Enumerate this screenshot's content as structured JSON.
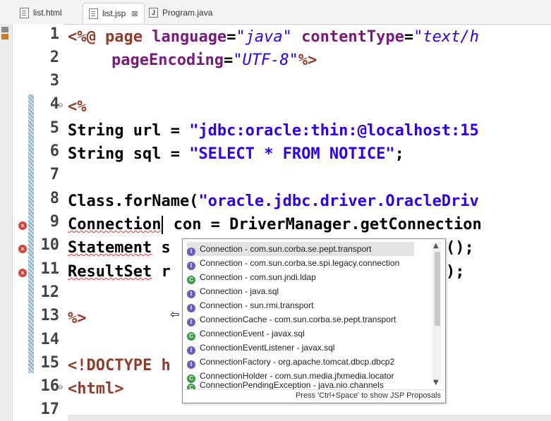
{
  "tabs": [
    {
      "label": "list.html",
      "active": false,
      "icon": "html-file-icon"
    },
    {
      "label": "list.jsp",
      "active": true,
      "icon": "jsp-file-icon"
    },
    {
      "label": "Program.java",
      "active": false,
      "icon": "java-file-icon"
    }
  ],
  "close_glyph": "⊠",
  "line_numbers": [
    "1",
    "2",
    "3",
    "4",
    "5",
    "6",
    "7",
    "8",
    "9",
    "10",
    "11",
    "12",
    "13",
    "14",
    "15",
    "16",
    "17"
  ],
  "code": {
    "l1": {
      "open": "<%@ ",
      "kw": "page ",
      "a1": "language",
      "eq": "=",
      "v1": "\"java\"",
      "sp": " ",
      "a2": "contentType",
      "eq2": "=",
      "v2": "\"text/h"
    },
    "l2": {
      "a": "pageEncoding",
      "eq": "=",
      "v": "\"UTF-8\"",
      "close": "%>"
    },
    "l4": "<%",
    "l5": {
      "pre": "String url = ",
      "str": "\"jdbc:oracle:thin:@localhost:15"
    },
    "l6": {
      "pre": "String sql = ",
      "str": "\"SELECT * FROM NOTICE\"",
      "post": ";"
    },
    "l8": {
      "pre": "Class.forName(",
      "str": "\"oracle.jdbc.driver.OracleDriv"
    },
    "l9": {
      "a": "Connection",
      "b": " con = DriverManager.getConnection"
    },
    "l10": {
      "a": "Statement",
      "b": " s",
      "c": "();"
    },
    "l11": {
      "a": "ResultSet",
      "b": " r",
      "c": ");"
    },
    "l13": "%>",
    "l15": "<!DOCTYPE h",
    "l16": "<html>"
  },
  "popup": {
    "items": [
      {
        "label": "Connection - com.sun.corba.se.pept.transport",
        "kind": "interface"
      },
      {
        "label": "Connection - com.sun.corba.se.spi.legacy.connection",
        "kind": "interface"
      },
      {
        "label": "Connection - com.sun.jndi.ldap",
        "kind": "class"
      },
      {
        "label": "Connection - java.sql",
        "kind": "interface"
      },
      {
        "label": "Connection - sun.rmi.transport",
        "kind": "interface"
      },
      {
        "label": "ConnectionCache - com.sun.corba.se.pept.transport",
        "kind": "interface"
      },
      {
        "label": "ConnectionEvent - javax.sql",
        "kind": "class"
      },
      {
        "label": "ConnectionEventListener - javax.sql",
        "kind": "interface"
      },
      {
        "label": "ConnectionFactory - org.apache.tomcat.dbcp.dbcp2",
        "kind": "interface"
      },
      {
        "label": "ConnectionHolder - com.sun.media.jfxmedia.locator",
        "kind": "class"
      },
      {
        "label": "ConnectionPendingException - java.nio.channels",
        "kind": "class"
      }
    ],
    "hint": "Press 'Ctrl+Space' to show JSP Proposals"
  },
  "colors": {
    "tag": "#8f3c2b",
    "attribute": "#7a1a7a",
    "string": "#2a00ff",
    "error": "#d9433a",
    "selection": "#e4e4e4"
  }
}
